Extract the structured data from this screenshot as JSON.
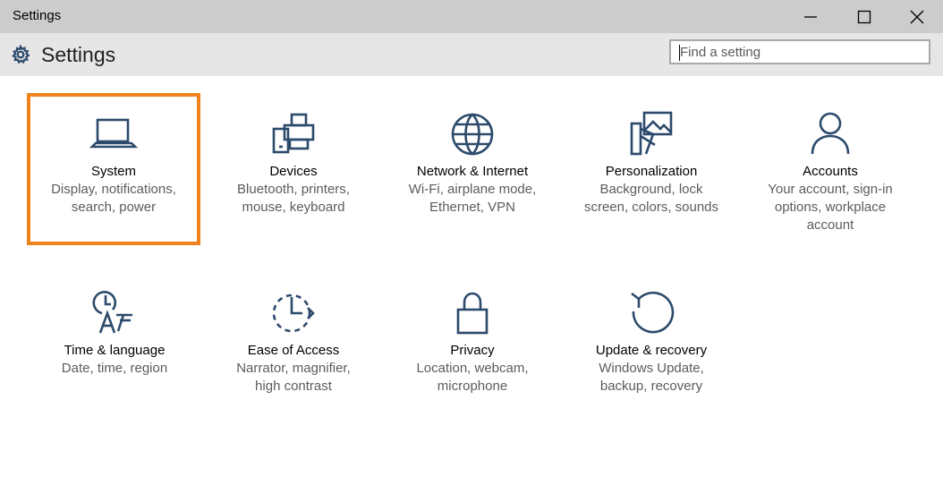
{
  "window": {
    "title": "Settings"
  },
  "header": {
    "title": "Settings",
    "search_placeholder": "Find a setting"
  },
  "tiles": [
    {
      "id": "system",
      "title": "System",
      "description": "Display, notifications, search, power",
      "icon": "laptop-icon",
      "selected": true
    },
    {
      "id": "devices",
      "title": "Devices",
      "description": "Bluetooth, printers, mouse, keyboard",
      "icon": "devices-icon"
    },
    {
      "id": "network",
      "title": "Network & Internet",
      "description": "Wi-Fi, airplane mode, Ethernet, VPN",
      "icon": "globe-icon"
    },
    {
      "id": "personalization",
      "title": "Personalization",
      "description": "Background, lock screen, colors, sounds",
      "icon": "personalization-icon"
    },
    {
      "id": "accounts",
      "title": "Accounts",
      "description": "Your account, sign-in options, workplace account",
      "icon": "person-icon"
    },
    {
      "id": "time",
      "title": "Time & language",
      "description": "Date, time, region",
      "icon": "time-language-icon"
    },
    {
      "id": "ease",
      "title": "Ease of Access",
      "description": "Narrator, magnifier, high contrast",
      "icon": "ease-of-access-icon"
    },
    {
      "id": "privacy",
      "title": "Privacy",
      "description": "Location, webcam, microphone",
      "icon": "lock-icon"
    },
    {
      "id": "update",
      "title": "Update & recovery",
      "description": "Windows Update, backup, recovery",
      "icon": "refresh-icon"
    }
  ],
  "colors": {
    "accent_highlight": "#f0821e",
    "icon_stroke": "#2c4a6c",
    "titlebar_bg": "#cccccc",
    "header_bg": "#e6e6e6"
  }
}
